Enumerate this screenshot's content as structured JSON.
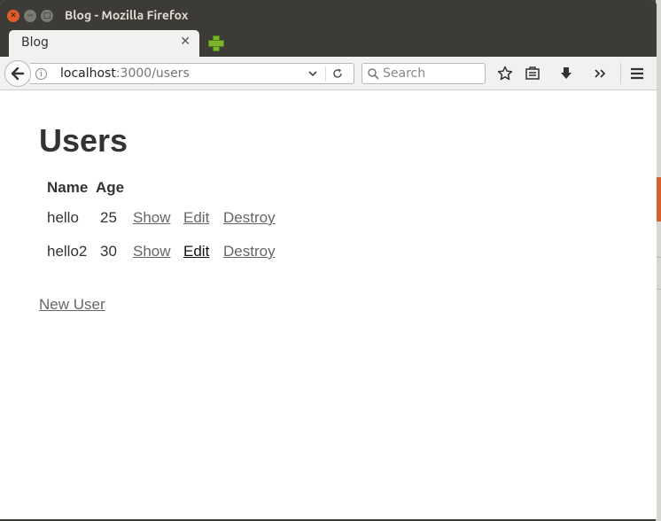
{
  "window": {
    "title": "Blog - Mozilla Firefox"
  },
  "tab": {
    "label": "Blog"
  },
  "address": {
    "host": "localhost",
    "path": ":3000/users"
  },
  "search": {
    "placeholder": "Search"
  },
  "page": {
    "heading": "Users",
    "columns": [
      "Name",
      "Age"
    ],
    "rows": [
      {
        "name": "hello",
        "age": "25",
        "show": "Show",
        "edit": "Edit",
        "destroy": "Destroy"
      },
      {
        "name": "hello2",
        "age": "30",
        "show": "Show",
        "edit": "Edit",
        "destroy": "Destroy"
      }
    ],
    "new_user": "New User"
  },
  "colors": {
    "close_button": "#e25b2a",
    "titlebar": "#3c3b37",
    "newtab_plus": "#7cb52c",
    "link": "#666666"
  }
}
